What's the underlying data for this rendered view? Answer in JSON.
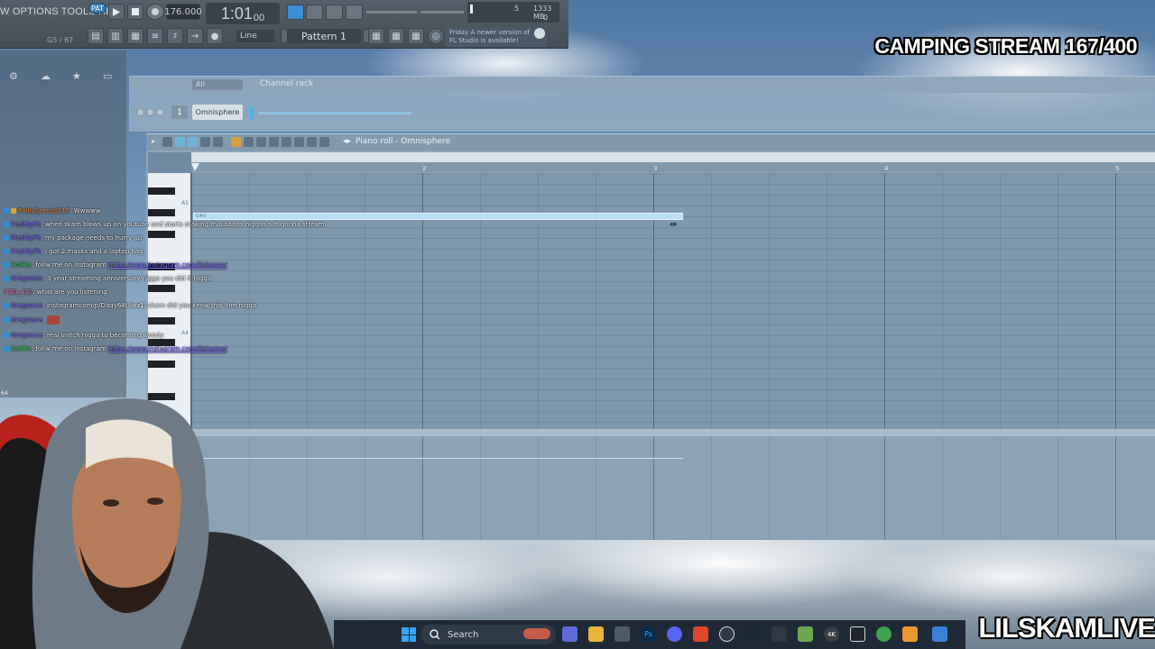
{
  "menu": {
    "text": "W  OPTIONS  TOOLS  HELP"
  },
  "transport": {
    "pat_label": "PAT",
    "bpm": "176.000",
    "time_main": "1:01",
    "time_sub": "00",
    "cpu_value": "5",
    "memory": "1333 MB",
    "poly": "0"
  },
  "browser": {
    "counter": "G5 / 67"
  },
  "toolbar2": {
    "snap_label": "Line",
    "pattern_label": "Pattern 1",
    "news_text_1": "Friday  A newer version of",
    "news_text_2": "FL Studio is available!"
  },
  "channel_rack": {
    "filter": "All",
    "title": "Channel rack",
    "channel_number": "1",
    "channel_name": "Omnisphere"
  },
  "piano_roll": {
    "title": "Piano roll - Omnisphere",
    "bars": [
      "2",
      "3",
      "4",
      "5"
    ],
    "key_labels": [
      "A5",
      "A4"
    ],
    "note_label": "G#5"
  },
  "chat": {
    "lines": [
      {
        "user": "PhillySpecial215",
        "text": ": Wwwww"
      },
      {
        "user": "FreshlyPh",
        "text": ": when skam blows up on youtube and starts making thousands niggas not gonna stream"
      },
      {
        "user": "FreshlyPh",
        "text": ": my package needs to hurry up"
      },
      {
        "user": "FreshlyPh",
        "text": ": i got 2 masks and a laptop bag"
      },
      {
        "user": "BotRix",
        "text": ": follw me on instagram ",
        "link": "https://www.instagram.com/lilskamw/"
      },
      {
        "user": "Gregwave",
        "text": ": 3 year streaming anniversary nigga you did it nigga"
      },
      {
        "user": "l420_420",
        "text": ": what are you listening"
      },
      {
        "user": "Gregwave",
        "text": ": instagramcom/p/Daqy68Uiwz1/ skam did you know this lore nigga"
      },
      {
        "user": "Gregwave",
        "text": ":"
      },
      {
        "user": "Gregwave",
        "text": ": real snitch nigga to becoming woody"
      },
      {
        "user": "BotRix",
        "text": ": follw me on instagram ",
        "link": "https://www.instagram.com/lilskamw/"
      }
    ],
    "side_number": "64"
  },
  "overlay": {
    "stream_title": "CAMPING STREAM 167/400",
    "brand": "LILSKAMLIVE"
  },
  "taskbar": {
    "search_label": "Search"
  },
  "colors": {
    "note": "#b8dff7",
    "accent_blue": "#2e79b8",
    "chat_user": "#8b6cff",
    "bot_user": "#3fd36a"
  }
}
